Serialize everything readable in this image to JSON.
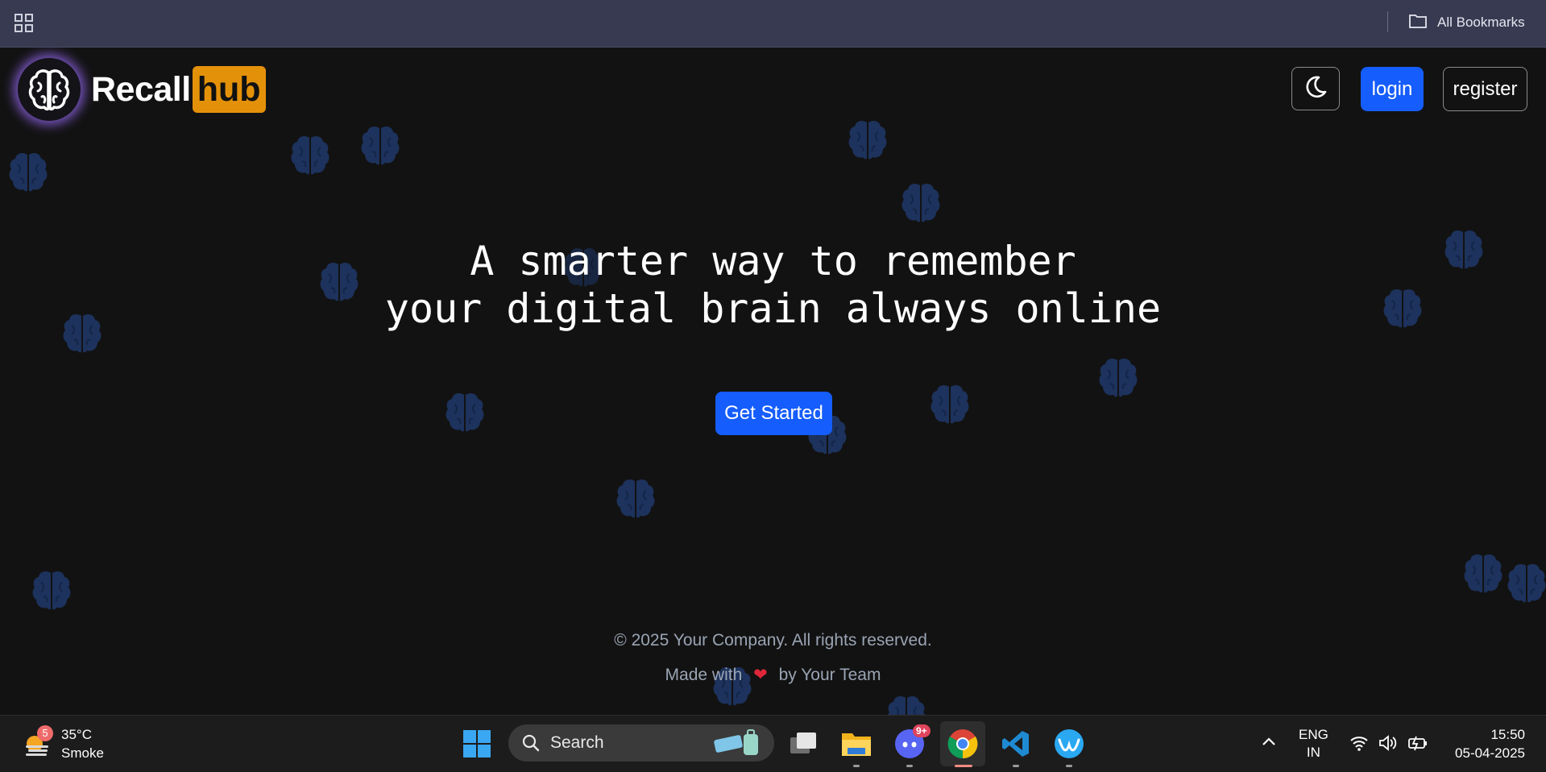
{
  "bookmarks_bar": {
    "all_bookmarks_label": "All Bookmarks"
  },
  "header": {
    "logo_recall": "Recall",
    "logo_hub": "hub",
    "login_label": "login",
    "register_label": "register"
  },
  "hero": {
    "line1": "A smarter way to remember",
    "line2": "your digital brain always online",
    "cta_label": "Get Started"
  },
  "footer": {
    "copyright": "© 2025 Your Company. All rights reserved.",
    "made_prefix": "Made with",
    "made_heart": "❤",
    "made_suffix": "by Your Team"
  },
  "taskbar": {
    "weather_temp": "35°C",
    "weather_desc": "Smoke",
    "weather_badge": "5",
    "search_label": "Search",
    "discord_badge": "9+",
    "lang_line1": "ENG",
    "lang_line2": "IN",
    "time": "15:50",
    "date": "05-04-2025"
  },
  "colors": {
    "accent_blue": "#155dfc",
    "hub_orange": "#e4910a",
    "brain_bg": "#1e3461"
  }
}
